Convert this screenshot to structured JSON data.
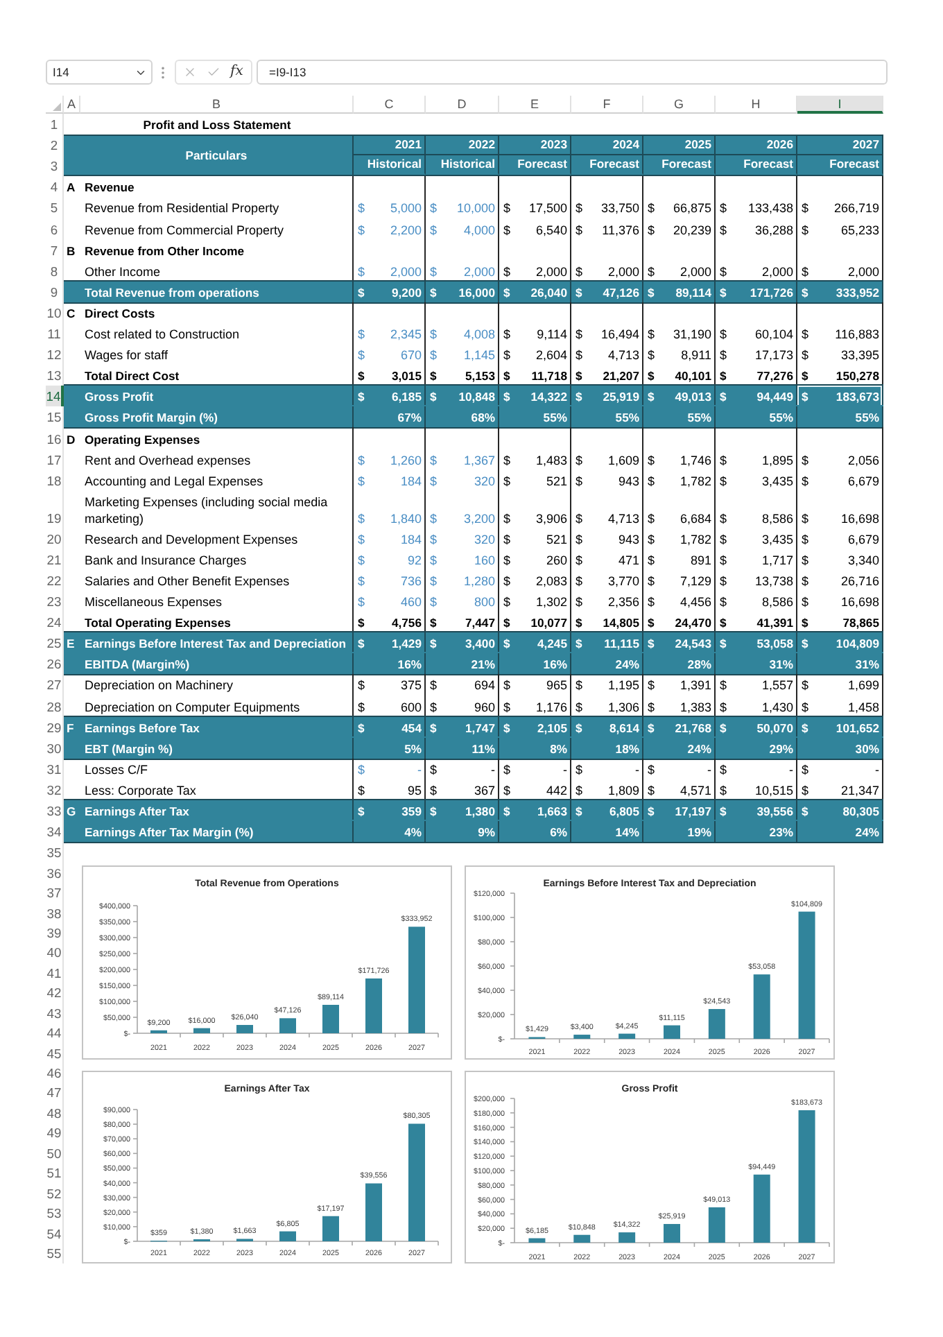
{
  "formula_bar": {
    "name_box": "I14",
    "function_label": "fx",
    "formula": "=I9-I13"
  },
  "column_headers": [
    {
      "label": "A",
      "selected": false
    },
    {
      "label": "B",
      "selected": false
    },
    {
      "label": "C",
      "selected": false
    },
    {
      "label": "D",
      "selected": false
    },
    {
      "label": "E",
      "selected": false
    },
    {
      "label": "F",
      "selected": false
    },
    {
      "label": "G",
      "selected": false
    },
    {
      "label": "H",
      "selected": false
    },
    {
      "label": "I",
      "selected": true
    }
  ],
  "row_headers": [
    {
      "label": "1",
      "selected": false
    },
    {
      "label": "2",
      "selected": false
    },
    {
      "label": "3",
      "selected": false
    },
    {
      "label": "4",
      "selected": false
    },
    {
      "label": "5",
      "selected": false
    },
    {
      "label": "6",
      "selected": false
    },
    {
      "label": "7",
      "selected": false
    },
    {
      "label": "8",
      "selected": false
    },
    {
      "label": "9",
      "selected": false
    },
    {
      "label": "10",
      "selected": false
    },
    {
      "label": "11",
      "selected": false
    },
    {
      "label": "12",
      "selected": false
    },
    {
      "label": "13",
      "selected": false
    },
    {
      "label": "14",
      "selected": true
    },
    {
      "label": "15",
      "selected": false
    },
    {
      "label": "16",
      "selected": false
    },
    {
      "label": "17",
      "selected": false
    },
    {
      "label": "18",
      "selected": false
    },
    {
      "label": "19",
      "selected": false
    },
    {
      "label": "20",
      "selected": false
    },
    {
      "label": "21",
      "selected": false
    },
    {
      "label": "22",
      "selected": false
    },
    {
      "label": "23",
      "selected": false
    },
    {
      "label": "24",
      "selected": false
    },
    {
      "label": "25",
      "selected": false
    },
    {
      "label": "26",
      "selected": false
    },
    {
      "label": "27",
      "selected": false
    },
    {
      "label": "28",
      "selected": false
    },
    {
      "label": "29",
      "selected": false
    },
    {
      "label": "30",
      "selected": false
    },
    {
      "label": "31",
      "selected": false
    },
    {
      "label": "32",
      "selected": false
    },
    {
      "label": "33",
      "selected": false
    },
    {
      "label": "34",
      "selected": false
    },
    {
      "label": "35",
      "selected": false
    },
    {
      "label": "36",
      "selected": false
    },
    {
      "label": "37",
      "selected": false
    },
    {
      "label": "38",
      "selected": false
    },
    {
      "label": "39",
      "selected": false
    },
    {
      "label": "40",
      "selected": false
    },
    {
      "label": "41",
      "selected": false
    },
    {
      "label": "42",
      "selected": false
    },
    {
      "label": "43",
      "selected": false
    },
    {
      "label": "44",
      "selected": false
    },
    {
      "label": "45",
      "selected": false
    },
    {
      "label": "46",
      "selected": false
    },
    {
      "label": "47",
      "selected": false
    },
    {
      "label": "48",
      "selected": false
    },
    {
      "label": "49",
      "selected": false
    },
    {
      "label": "50",
      "selected": false
    },
    {
      "label": "51",
      "selected": false
    },
    {
      "label": "52",
      "selected": false
    },
    {
      "label": "53",
      "selected": false
    },
    {
      "label": "54",
      "selected": false
    },
    {
      "label": "55",
      "selected": false
    }
  ],
  "sheet": {
    "title": "Profit and Loss Statement",
    "header": {
      "label": "Particulars",
      "years": [
        "2021",
        "2022",
        "2023",
        "2024",
        "2025",
        "2026",
        "2027"
      ],
      "periods": [
        "Historical",
        "Historical",
        "Forecast",
        "Forecast",
        "Forecast",
        "Forecast",
        "Forecast"
      ]
    },
    "rows": [
      {
        "kind": "section",
        "letter": "A",
        "label": "Revenue"
      },
      {
        "kind": "item",
        "label": "Revenue from Residential Property",
        "cells": [
          {
            "currency": "$",
            "amount": "5,000",
            "input": true
          },
          {
            "currency": "$",
            "amount": "10,000",
            "input": true
          },
          {
            "currency": "$",
            "amount": "17,500",
            "input": false
          },
          {
            "currency": "$",
            "amount": "33,750",
            "input": false
          },
          {
            "currency": "$",
            "amount": "66,875",
            "input": false
          },
          {
            "currency": "$",
            "amount": "133,438",
            "input": false
          },
          {
            "currency": "$",
            "amount": "266,719",
            "input": false
          }
        ]
      },
      {
        "kind": "item",
        "label": "Revenue from Commercial Property",
        "cells": [
          {
            "currency": "$",
            "amount": "2,200",
            "input": true
          },
          {
            "currency": "$",
            "amount": "4,000",
            "input": true
          },
          {
            "currency": "$",
            "amount": "6,540",
            "input": false
          },
          {
            "currency": "$",
            "amount": "11,376",
            "input": false
          },
          {
            "currency": "$",
            "amount": "20,239",
            "input": false
          },
          {
            "currency": "$",
            "amount": "36,288",
            "input": false
          },
          {
            "currency": "$",
            "amount": "65,233",
            "input": false
          }
        ]
      },
      {
        "kind": "section",
        "letter": "B",
        "label": "Revenue from Other Income"
      },
      {
        "kind": "item",
        "label": "Other Income",
        "cells": [
          {
            "currency": "$",
            "amount": "2,000",
            "input": true
          },
          {
            "currency": "$",
            "amount": "2,000",
            "input": true
          },
          {
            "currency": "$",
            "amount": "2,000",
            "input": false
          },
          {
            "currency": "$",
            "amount": "2,000",
            "input": false
          },
          {
            "currency": "$",
            "amount": "2,000",
            "input": false
          },
          {
            "currency": "$",
            "amount": "2,000",
            "input": false
          },
          {
            "currency": "$",
            "amount": "2,000",
            "input": false
          }
        ]
      },
      {
        "kind": "band",
        "label": "Total Revenue from operations",
        "cells": [
          {
            "currency": "$",
            "amount": "9,200",
            "input": false
          },
          {
            "currency": "$",
            "amount": "16,000",
            "input": false
          },
          {
            "currency": "$",
            "amount": "26,040",
            "input": false
          },
          {
            "currency": "$",
            "amount": "47,126",
            "input": false
          },
          {
            "currency": "$",
            "amount": "89,114",
            "input": false
          },
          {
            "currency": "$",
            "amount": "171,726",
            "input": false
          },
          {
            "currency": "$",
            "amount": "333,952",
            "input": false
          }
        ]
      },
      {
        "kind": "section",
        "letter": "C",
        "label": "Direct Costs"
      },
      {
        "kind": "item",
        "label": "Cost related to Construction",
        "cells": [
          {
            "currency": "$",
            "amount": "2,345",
            "input": true
          },
          {
            "currency": "$",
            "amount": "4,008",
            "input": true
          },
          {
            "currency": "$",
            "amount": "9,114",
            "input": false
          },
          {
            "currency": "$",
            "amount": "16,494",
            "input": false
          },
          {
            "currency": "$",
            "amount": "31,190",
            "input": false
          },
          {
            "currency": "$",
            "amount": "60,104",
            "input": false
          },
          {
            "currency": "$",
            "amount": "116,883",
            "input": false
          }
        ]
      },
      {
        "kind": "item",
        "label": "Wages for staff",
        "cells": [
          {
            "currency": "$",
            "amount": "670",
            "input": true
          },
          {
            "currency": "$",
            "amount": "1,145",
            "input": true
          },
          {
            "currency": "$",
            "amount": "2,604",
            "input": false
          },
          {
            "currency": "$",
            "amount": "4,713",
            "input": false
          },
          {
            "currency": "$",
            "amount": "8,911",
            "input": false
          },
          {
            "currency": "$",
            "amount": "17,173",
            "input": false
          },
          {
            "currency": "$",
            "amount": "33,395",
            "input": false
          }
        ]
      },
      {
        "kind": "total",
        "label": "Total Direct Cost",
        "cells": [
          {
            "currency": "$",
            "amount": "3,015",
            "input": false
          },
          {
            "currency": "$",
            "amount": "5,153",
            "input": false
          },
          {
            "currency": "$",
            "amount": "11,718",
            "input": false
          },
          {
            "currency": "$",
            "amount": "21,207",
            "input": false
          },
          {
            "currency": "$",
            "amount": "40,101",
            "input": false
          },
          {
            "currency": "$",
            "amount": "77,276",
            "input": false
          },
          {
            "currency": "$",
            "amount": "150,278",
            "input": false
          }
        ]
      },
      {
        "kind": "band",
        "label": "Gross Profit",
        "cells": [
          {
            "currency": "$",
            "amount": "6,185",
            "input": false
          },
          {
            "currency": "$",
            "amount": "10,848",
            "input": false
          },
          {
            "currency": "$",
            "amount": "14,322",
            "input": false
          },
          {
            "currency": "$",
            "amount": "25,919",
            "input": false
          },
          {
            "currency": "$",
            "amount": "49,013",
            "input": false
          },
          {
            "currency": "$",
            "amount": "94,449",
            "input": false
          },
          {
            "currency": "$",
            "amount": "183,673",
            "input": false
          }
        ]
      },
      {
        "kind": "band",
        "label": "Gross Profit Margin (%)",
        "cells": [
          {
            "amount": "67%",
            "input": false
          },
          {
            "amount": "68%",
            "input": false
          },
          {
            "amount": "55%",
            "input": false
          },
          {
            "amount": "55%",
            "input": false
          },
          {
            "amount": "55%",
            "input": false
          },
          {
            "amount": "55%",
            "input": false
          },
          {
            "amount": "55%",
            "input": false
          }
        ]
      },
      {
        "kind": "section",
        "letter": "D",
        "label": "Operating Expenses"
      },
      {
        "kind": "item",
        "label": "Rent and Overhead expenses",
        "cells": [
          {
            "currency": "$",
            "amount": "1,260",
            "input": true
          },
          {
            "currency": "$",
            "amount": "1,367",
            "input": true
          },
          {
            "currency": "$",
            "amount": "1,483",
            "input": false
          },
          {
            "currency": "$",
            "amount": "1,609",
            "input": false
          },
          {
            "currency": "$",
            "amount": "1,746",
            "input": false
          },
          {
            "currency": "$",
            "amount": "1,895",
            "input": false
          },
          {
            "currency": "$",
            "amount": "2,056",
            "input": false
          }
        ]
      },
      {
        "kind": "item",
        "label": "Accounting and Legal Expenses",
        "cells": [
          {
            "currency": "$",
            "amount": "184",
            "input": true
          },
          {
            "currency": "$",
            "amount": "320",
            "input": true
          },
          {
            "currency": "$",
            "amount": "521",
            "input": false
          },
          {
            "currency": "$",
            "amount": "943",
            "input": false
          },
          {
            "currency": "$",
            "amount": "1,782",
            "input": false
          },
          {
            "currency": "$",
            "amount": "3,435",
            "input": false
          },
          {
            "currency": "$",
            "amount": "6,679",
            "input": false
          }
        ]
      },
      {
        "kind": "item",
        "label": "Marketing Expenses (including social media marketing)",
        "cells": [
          {
            "currency": "$",
            "amount": "1,840",
            "input": true
          },
          {
            "currency": "$",
            "amount": "3,200",
            "input": true
          },
          {
            "currency": "$",
            "amount": "3,906",
            "input": false
          },
          {
            "currency": "$",
            "amount": "4,713",
            "input": false
          },
          {
            "currency": "$",
            "amount": "6,684",
            "input": false
          },
          {
            "currency": "$",
            "amount": "8,586",
            "input": false
          },
          {
            "currency": "$",
            "amount": "16,698",
            "input": false
          }
        ]
      },
      {
        "kind": "item",
        "label": "Research and Development Expenses",
        "cells": [
          {
            "currency": "$",
            "amount": "184",
            "input": true
          },
          {
            "currency": "$",
            "amount": "320",
            "input": true
          },
          {
            "currency": "$",
            "amount": "521",
            "input": false
          },
          {
            "currency": "$",
            "amount": "943",
            "input": false
          },
          {
            "currency": "$",
            "amount": "1,782",
            "input": false
          },
          {
            "currency": "$",
            "amount": "3,435",
            "input": false
          },
          {
            "currency": "$",
            "amount": "6,679",
            "input": false
          }
        ]
      },
      {
        "kind": "item",
        "label": "Bank and Insurance Charges",
        "cells": [
          {
            "currency": "$",
            "amount": "92",
            "input": true
          },
          {
            "currency": "$",
            "amount": "160",
            "input": true
          },
          {
            "currency": "$",
            "amount": "260",
            "input": false
          },
          {
            "currency": "$",
            "amount": "471",
            "input": false
          },
          {
            "currency": "$",
            "amount": "891",
            "input": false
          },
          {
            "currency": "$",
            "amount": "1,717",
            "input": false
          },
          {
            "currency": "$",
            "amount": "3,340",
            "input": false
          }
        ]
      },
      {
        "kind": "item",
        "label": "Salaries and Other Benefit Expenses",
        "cells": [
          {
            "currency": "$",
            "amount": "736",
            "input": true
          },
          {
            "currency": "$",
            "amount": "1,280",
            "input": true
          },
          {
            "currency": "$",
            "amount": "2,083",
            "input": false
          },
          {
            "currency": "$",
            "amount": "3,770",
            "input": false
          },
          {
            "currency": "$",
            "amount": "7,129",
            "input": false
          },
          {
            "currency": "$",
            "amount": "13,738",
            "input": false
          },
          {
            "currency": "$",
            "amount": "26,716",
            "input": false
          }
        ]
      },
      {
        "kind": "item",
        "label": "Miscellaneous Expenses",
        "cells": [
          {
            "currency": "$",
            "amount": "460",
            "input": true
          },
          {
            "currency": "$",
            "amount": "800",
            "input": true
          },
          {
            "currency": "$",
            "amount": "1,302",
            "input": false
          },
          {
            "currency": "$",
            "amount": "2,356",
            "input": false
          },
          {
            "currency": "$",
            "amount": "4,456",
            "input": false
          },
          {
            "currency": "$",
            "amount": "8,586",
            "input": false
          },
          {
            "currency": "$",
            "amount": "16,698",
            "input": false
          }
        ]
      },
      {
        "kind": "total",
        "label": "Total Operating Expenses",
        "cells": [
          {
            "currency": "$",
            "amount": "4,756",
            "input": false
          },
          {
            "currency": "$",
            "amount": "7,447",
            "input": false
          },
          {
            "currency": "$",
            "amount": "10,077",
            "input": false
          },
          {
            "currency": "$",
            "amount": "14,805",
            "input": false
          },
          {
            "currency": "$",
            "amount": "24,470",
            "input": false
          },
          {
            "currency": "$",
            "amount": "41,391",
            "input": false
          },
          {
            "currency": "$",
            "amount": "78,865",
            "input": false
          }
        ]
      },
      {
        "kind": "band",
        "letter": "E",
        "label": "Earnings Before Interest Tax and Depreciation",
        "cells": [
          {
            "currency": "$",
            "amount": "1,429",
            "input": false
          },
          {
            "currency": "$",
            "amount": "3,400",
            "input": false
          },
          {
            "currency": "$",
            "amount": "4,245",
            "input": false
          },
          {
            "currency": "$",
            "amount": "11,115",
            "input": false
          },
          {
            "currency": "$",
            "amount": "24,543",
            "input": false
          },
          {
            "currency": "$",
            "amount": "53,058",
            "input": false
          },
          {
            "currency": "$",
            "amount": "104,809",
            "input": false
          }
        ]
      },
      {
        "kind": "band",
        "label": "EBITDA (Margin%)",
        "cells": [
          {
            "amount": "16%",
            "input": false
          },
          {
            "amount": "21%",
            "input": false
          },
          {
            "amount": "16%",
            "input": false
          },
          {
            "amount": "24%",
            "input": false
          },
          {
            "amount": "28%",
            "input": false
          },
          {
            "amount": "31%",
            "input": false
          },
          {
            "amount": "31%",
            "input": false
          }
        ]
      },
      {
        "kind": "item",
        "label": "Depreciation on Machinery",
        "cells": [
          {
            "currency": "$",
            "amount": "375",
            "input": false
          },
          {
            "currency": "$",
            "amount": "694",
            "input": false
          },
          {
            "currency": "$",
            "amount": "965",
            "input": false
          },
          {
            "currency": "$",
            "amount": "1,195",
            "input": false
          },
          {
            "currency": "$",
            "amount": "1,391",
            "input": false
          },
          {
            "currency": "$",
            "amount": "1,557",
            "input": false
          },
          {
            "currency": "$",
            "amount": "1,699",
            "input": false
          }
        ]
      },
      {
        "kind": "item",
        "label": "Depreciation on Computer Equipments",
        "cells": [
          {
            "currency": "$",
            "amount": "600",
            "input": false
          },
          {
            "currency": "$",
            "amount": "960",
            "input": false
          },
          {
            "currency": "$",
            "amount": "1,176",
            "input": false
          },
          {
            "currency": "$",
            "amount": "1,306",
            "input": false
          },
          {
            "currency": "$",
            "amount": "1,383",
            "input": false
          },
          {
            "currency": "$",
            "amount": "1,430",
            "input": false
          },
          {
            "currency": "$",
            "amount": "1,458",
            "input": false
          }
        ]
      },
      {
        "kind": "band",
        "letter": "F",
        "label": "Earnings Before Tax",
        "cells": [
          {
            "currency": "$",
            "amount": "454",
            "input": false
          },
          {
            "currency": "$",
            "amount": "1,747",
            "input": false
          },
          {
            "currency": "$",
            "amount": "2,105",
            "input": false
          },
          {
            "currency": "$",
            "amount": "8,614",
            "input": false
          },
          {
            "currency": "$",
            "amount": "21,768",
            "input": false
          },
          {
            "currency": "$",
            "amount": "50,070",
            "input": false
          },
          {
            "currency": "$",
            "amount": "101,652",
            "input": false
          }
        ]
      },
      {
        "kind": "band",
        "label": "EBT (Margin %)",
        "cells": [
          {
            "amount": "5%",
            "input": false
          },
          {
            "amount": "11%",
            "input": false
          },
          {
            "amount": "8%",
            "input": false
          },
          {
            "amount": "18%",
            "input": false
          },
          {
            "amount": "24%",
            "input": false
          },
          {
            "amount": "29%",
            "input": false
          },
          {
            "amount": "30%",
            "input": false
          }
        ]
      },
      {
        "kind": "item",
        "label": "Losses C/F",
        "cells": [
          {
            "currency": "$",
            "amount": "-",
            "input": true
          },
          {
            "currency": "$",
            "amount": "-",
            "input": false
          },
          {
            "currency": "$",
            "amount": "-",
            "input": false
          },
          {
            "currency": "$",
            "amount": "-",
            "input": false
          },
          {
            "currency": "$",
            "amount": "-",
            "input": false
          },
          {
            "currency": "$",
            "amount": "-",
            "input": false
          },
          {
            "currency": "$",
            "amount": "-",
            "input": false
          }
        ]
      },
      {
        "kind": "item",
        "label": "Less: Corporate Tax",
        "cells": [
          {
            "currency": "$",
            "amount": "95",
            "input": false
          },
          {
            "currency": "$",
            "amount": "367",
            "input": false
          },
          {
            "currency": "$",
            "amount": "442",
            "input": false
          },
          {
            "currency": "$",
            "amount": "1,809",
            "input": false
          },
          {
            "currency": "$",
            "amount": "4,571",
            "input": false
          },
          {
            "currency": "$",
            "amount": "10,515",
            "input": false
          },
          {
            "currency": "$",
            "amount": "21,347",
            "input": false
          }
        ]
      },
      {
        "kind": "band",
        "letter": "G",
        "label": "Earnings After Tax",
        "cells": [
          {
            "currency": "$",
            "amount": "359",
            "input": false
          },
          {
            "currency": "$",
            "amount": "1,380",
            "input": false
          },
          {
            "currency": "$",
            "amount": "1,663",
            "input": false
          },
          {
            "currency": "$",
            "amount": "6,805",
            "input": false
          },
          {
            "currency": "$",
            "amount": "17,197",
            "input": false
          },
          {
            "currency": "$",
            "amount": "39,556",
            "input": false
          },
          {
            "currency": "$",
            "amount": "80,305",
            "input": false
          }
        ]
      },
      {
        "kind": "band",
        "label": "Earnings After Tax Margin (%)",
        "cells": [
          {
            "amount": "4%",
            "input": false
          },
          {
            "amount": "9%",
            "input": false
          },
          {
            "amount": "6%",
            "input": false
          },
          {
            "amount": "14%",
            "input": false
          },
          {
            "amount": "19%",
            "input": false
          },
          {
            "amount": "23%",
            "input": false
          },
          {
            "amount": "24%",
            "input": false
          }
        ]
      }
    ]
  },
  "charts": [
    {
      "chart_data": {
        "type": "bar",
        "title": "Total Revenue from Operations",
        "categories": [
          "2021",
          "2022",
          "2023",
          "2024",
          "2025",
          "2026",
          "2027"
        ],
        "values": [
          9200,
          16000,
          26040,
          47126,
          89114,
          171726,
          333952
        ],
        "ylim": [
          0,
          400000
        ],
        "yticks": [
          {
            "value": 0,
            "label": "$-"
          },
          {
            "value": 50000,
            "label": "$50,000"
          },
          {
            "value": 100000,
            "label": "$100,000"
          },
          {
            "value": 150000,
            "label": "$150,000"
          },
          {
            "value": 200000,
            "label": "$200,000"
          },
          {
            "value": 250000,
            "label": "$250,000"
          },
          {
            "value": 300000,
            "label": "$300,000"
          },
          {
            "value": 350000,
            "label": "$350,000"
          },
          {
            "value": 400000,
            "label": "$400,000"
          }
        ],
        "value_labels": [
          "$9,200",
          "$16,000",
          "$26,040",
          "$47,126",
          "$89,114",
          "$171,726",
          "$333,952"
        ]
      }
    },
    {
      "chart_data": {
        "type": "bar",
        "title": "Earnings Before Interest Tax and Depreciation",
        "categories": [
          "2021",
          "2022",
          "2023",
          "2024",
          "2025",
          "2026",
          "2027"
        ],
        "values": [
          1429,
          3400,
          4245,
          11115,
          24543,
          53058,
          104809
        ],
        "ylim": [
          0,
          120000
        ],
        "yticks": [
          {
            "value": 0,
            "label": "$-"
          },
          {
            "value": 20000,
            "label": "$20,000"
          },
          {
            "value": 40000,
            "label": "$40,000"
          },
          {
            "value": 60000,
            "label": "$60,000"
          },
          {
            "value": 80000,
            "label": "$80,000"
          },
          {
            "value": 100000,
            "label": "$100,000"
          },
          {
            "value": 120000,
            "label": "$120,000"
          }
        ],
        "value_labels": [
          "$1,429",
          "$3,400",
          "$4,245",
          "$11,115",
          "$24,543",
          "$53,058",
          "$104,809"
        ]
      }
    },
    {
      "chart_data": {
        "type": "bar",
        "title": "Earnings After Tax",
        "categories": [
          "2021",
          "2022",
          "2023",
          "2024",
          "2025",
          "2026",
          "2027"
        ],
        "values": [
          359,
          1380,
          1663,
          6805,
          17197,
          39556,
          80305
        ],
        "ylim": [
          0,
          90000
        ],
        "yticks": [
          {
            "value": 0,
            "label": "$-"
          },
          {
            "value": 10000,
            "label": "$10,000"
          },
          {
            "value": 20000,
            "label": "$20,000"
          },
          {
            "value": 30000,
            "label": "$30,000"
          },
          {
            "value": 40000,
            "label": "$40,000"
          },
          {
            "value": 50000,
            "label": "$50,000"
          },
          {
            "value": 60000,
            "label": "$60,000"
          },
          {
            "value": 70000,
            "label": "$70,000"
          },
          {
            "value": 80000,
            "label": "$80,000"
          },
          {
            "value": 90000,
            "label": "$90,000"
          }
        ],
        "value_labels": [
          "$359",
          "$1,380",
          "$1,663",
          "$6,805",
          "$17,197",
          "$39,556",
          "$80,305"
        ]
      }
    },
    {
      "chart_data": {
        "type": "bar",
        "title": "Gross Profit",
        "categories": [
          "2021",
          "2022",
          "2023",
          "2024",
          "2025",
          "2026",
          "2027"
        ],
        "values": [
          6185,
          10848,
          14322,
          25919,
          49013,
          94449,
          183673
        ],
        "ylim": [
          0,
          200000
        ],
        "yticks": [
          {
            "value": 0,
            "label": "$-"
          },
          {
            "value": 20000,
            "label": "$20,000"
          },
          {
            "value": 40000,
            "label": "$40,000"
          },
          {
            "value": 60000,
            "label": "$60,000"
          },
          {
            "value": 80000,
            "label": "$80,000"
          },
          {
            "value": 100000,
            "label": "$100,000"
          },
          {
            "value": 120000,
            "label": "$120,000"
          },
          {
            "value": 140000,
            "label": "$140,000"
          },
          {
            "value": 160000,
            "label": "$160,000"
          },
          {
            "value": 180000,
            "label": "$180,000"
          },
          {
            "value": 200000,
            "label": "$200,000"
          }
        ],
        "value_labels": [
          "$6,185",
          "$10,848",
          "$14,322",
          "$25,919",
          "$49,013",
          "$94,449",
          "$183,673"
        ]
      }
    }
  ]
}
